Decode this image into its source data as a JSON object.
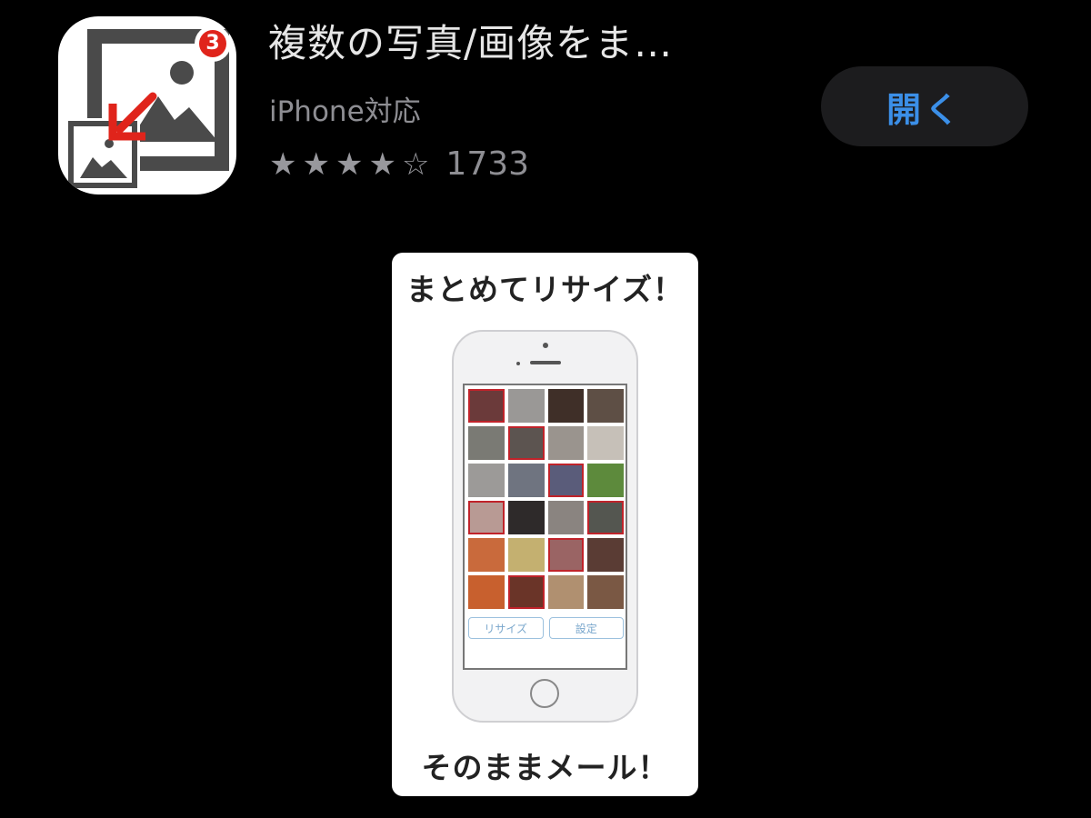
{
  "app": {
    "title": "複数の写真/画像をま…",
    "subtitle": "iPhone対応",
    "rating": {
      "stars_filled": 4,
      "stars_total": 5,
      "filled_glyph": "★",
      "empty_glyph": "☆",
      "count": "1733"
    },
    "open_button_label": "開く",
    "icon": {
      "name": "photo-resize-app-icon",
      "badge_count": "3",
      "colors": {
        "gray": "#4a4a4a",
        "red": "#e0241b",
        "background": "#ffffff"
      }
    }
  },
  "screenshot_preview": {
    "caption_top": "まとめてリサイズ！",
    "caption_bottom": "そのままメール！",
    "phone_screen": {
      "buttons": [
        "リサイズ",
        "設定"
      ],
      "grid": {
        "columns": 4,
        "rows": 6,
        "cells": [
          {
            "color": "#6b3a3a",
            "selected": true
          },
          {
            "color": "#9a9896",
            "selected": false
          },
          {
            "color": "#3f2f28",
            "selected": false
          },
          {
            "color": "#5e4f45",
            "selected": false
          },
          {
            "color": "#7a7a74",
            "selected": false
          },
          {
            "color": "#5c5450",
            "selected": true
          },
          {
            "color": "#9a948e",
            "selected": false
          },
          {
            "color": "#c6c0b8",
            "selected": false
          },
          {
            "color": "#9c9a98",
            "selected": false
          },
          {
            "color": "#6f7480",
            "selected": false
          },
          {
            "color": "#5a5c7a",
            "selected": true
          },
          {
            "color": "#5d8a3c",
            "selected": false
          },
          {
            "color": "#b89a94",
            "selected": true
          },
          {
            "color": "#2e2a2a",
            "selected": false
          },
          {
            "color": "#8a8480",
            "selected": false
          },
          {
            "color": "#545650",
            "selected": true
          },
          {
            "color": "#c96a3c",
            "selected": false
          },
          {
            "color": "#c4b070",
            "selected": false
          },
          {
            "color": "#9a6464",
            "selected": true
          },
          {
            "color": "#5a3c34",
            "selected": false
          },
          {
            "color": "#c8602e",
            "selected": false
          },
          {
            "color": "#6a3428",
            "selected": true
          },
          {
            "color": "#b09070",
            "selected": false
          },
          {
            "color": "#7a5844",
            "selected": false
          }
        ]
      }
    }
  },
  "colors": {
    "background": "#000000",
    "title_text": "#e6e6e6",
    "secondary_text": "#8e8e93",
    "button_bg": "#1c1c1e",
    "button_text": "#3b8fe8"
  }
}
